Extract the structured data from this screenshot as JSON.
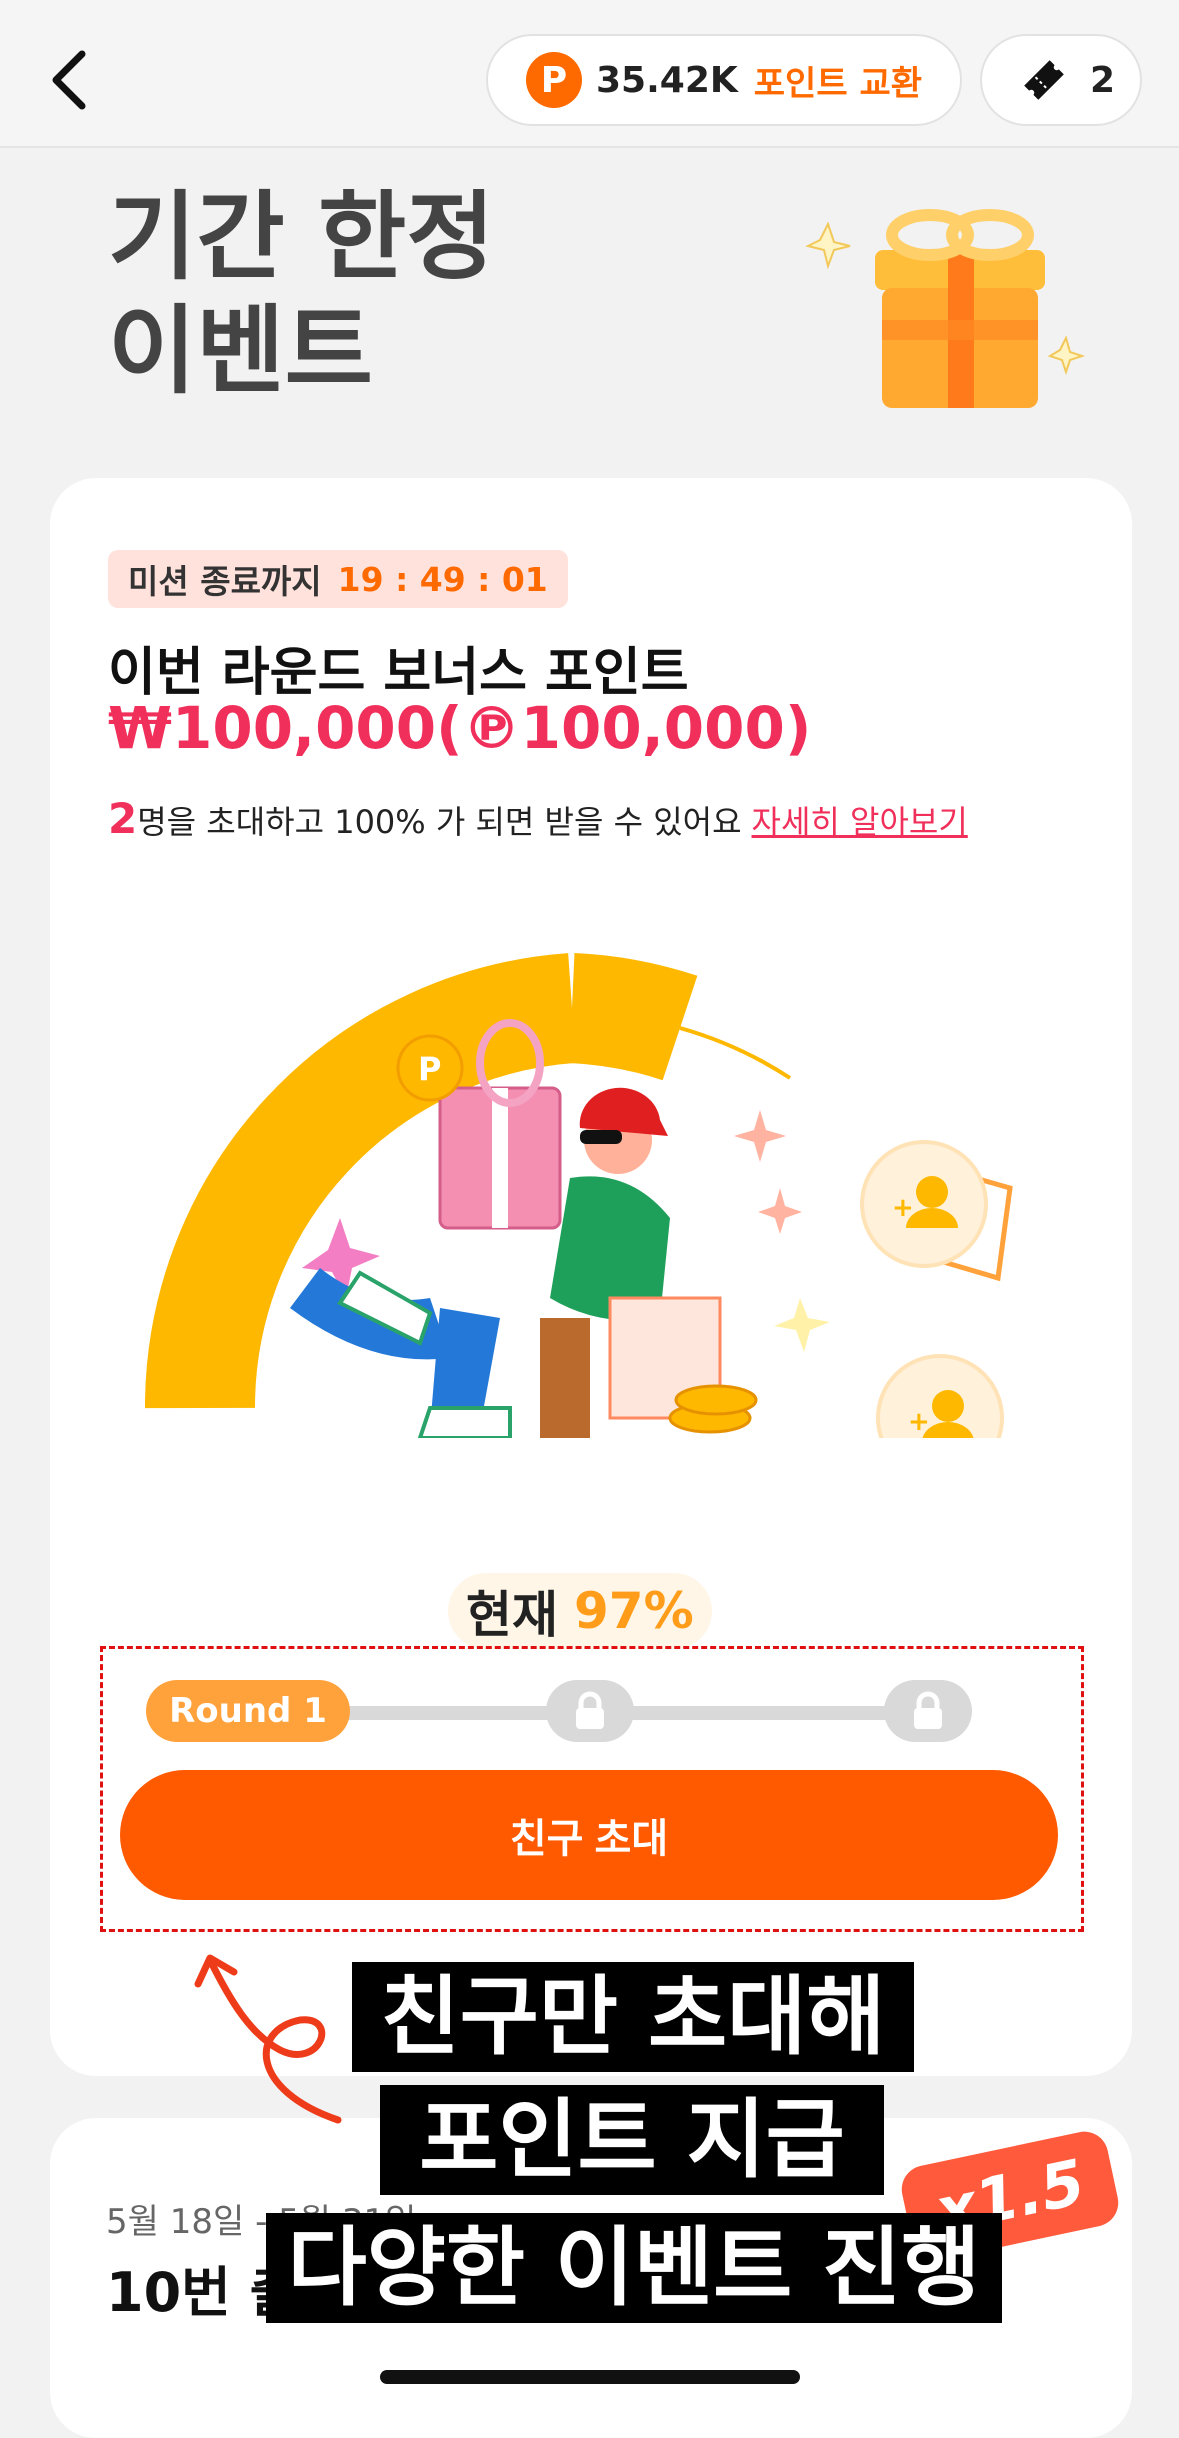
{
  "header": {
    "points_value": "35.42K",
    "points_exchange": "포인트 교환",
    "points_coin": "P",
    "ticket_count": "2"
  },
  "hero": {
    "title_line1": "기간 한정",
    "title_line2": "이벤트"
  },
  "mission_card": {
    "timer_label": "미션 종료까지",
    "timer_value": "19 : 49 : 01",
    "round_title": "이번 라운드 보너스 포인트",
    "amount": "₩100,000(℗100,000)",
    "desc_num": "2",
    "desc_text": "명을 초대하고 100% 가 되면 받을 수 있어요",
    "desc_link": "자세히 알아보기",
    "current_label": "현재",
    "current_value": "97%",
    "progress": 0.97,
    "round_label": "Round 1",
    "invite_button": "친구 초대"
  },
  "second_card": {
    "date": "5월 18일 - 5월 31일",
    "title": "10번 출석 체크",
    "badge": "x1.5"
  },
  "captions": {
    "line1": "친구만 초대해도",
    "line2": "포인트 지급 등",
    "line3": "다양한 이벤트 진행 중"
  },
  "colors": {
    "accent": "#ff5a00",
    "gauge": "#ffb800",
    "highlight": "#f0305b"
  }
}
